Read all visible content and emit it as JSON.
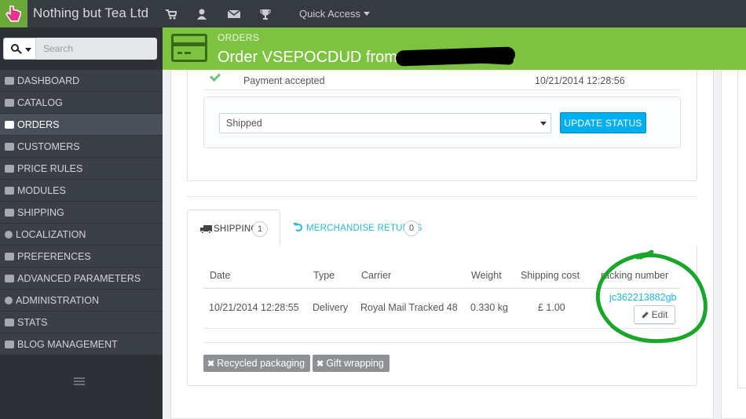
{
  "header": {
    "shop_name": "Nothing but Tea Ltd",
    "quick_access_label": "Quick Access",
    "icons": [
      "cart-icon",
      "user-icon",
      "envelope-icon",
      "trophy-icon"
    ]
  },
  "sidebar": {
    "search_placeholder": "Search",
    "items": [
      {
        "label": "DASHBOARD",
        "icon": "dashboard-icon",
        "active": false
      },
      {
        "label": "CATALOG",
        "icon": "book-icon",
        "active": false
      },
      {
        "label": "ORDERS",
        "icon": "credit-card-icon",
        "active": true
      },
      {
        "label": "CUSTOMERS",
        "icon": "users-icon",
        "active": false
      },
      {
        "label": "PRICE RULES",
        "icon": "tags-icon",
        "active": false
      },
      {
        "label": "MODULES",
        "icon": "puzzle-icon",
        "active": false
      },
      {
        "label": "SHIPPING",
        "icon": "truck-icon",
        "active": false
      },
      {
        "label": "LOCALIZATION",
        "icon": "globe-icon",
        "active": false
      },
      {
        "label": "PREFERENCES",
        "icon": "wrench-icon",
        "active": false
      },
      {
        "label": "ADVANCED PARAMETERS",
        "icon": "cogs-icon",
        "active": false
      },
      {
        "label": "ADMINISTRATION",
        "icon": "cog-icon",
        "active": false
      },
      {
        "label": "STATS",
        "icon": "bar-chart-icon",
        "active": false
      },
      {
        "label": "BLOG MANAGEMENT",
        "icon": "pencil-icon",
        "active": false
      }
    ]
  },
  "page_header": {
    "breadcrumb": "ORDERS",
    "title": "Order VSEPOCDUD from"
  },
  "history": {
    "status": "Payment accepted",
    "date": "10/21/2014 12:28:56"
  },
  "status_form": {
    "selected": "Shipped",
    "button": "UPDATE STATUS"
  },
  "tabs": {
    "shipping_label": "SHIPPING",
    "shipping_count": "1",
    "returns_label": "MERCHANDISE RETURNS",
    "returns_count": "0"
  },
  "shipping_table": {
    "headers": [
      "Date",
      "Type",
      "Carrier",
      "Weight",
      "Shipping cost",
      "racking number"
    ],
    "row": {
      "date": "10/21/2014 12:28:55",
      "type": "Delivery",
      "carrier": "Royal Mail Tracked 48",
      "weight": "0.330 kg",
      "cost": "£ 1.00",
      "tracking": "jc362213882gb",
      "edit": "Edit"
    }
  },
  "options": {
    "recycled": "Recycled packaging",
    "gift": "Gift wrapping"
  },
  "colors": {
    "accent_green": "#7ec242",
    "link_blue": "#25b9d7",
    "button_blue": "#00aff0",
    "annotation_green": "#1aa52b"
  }
}
